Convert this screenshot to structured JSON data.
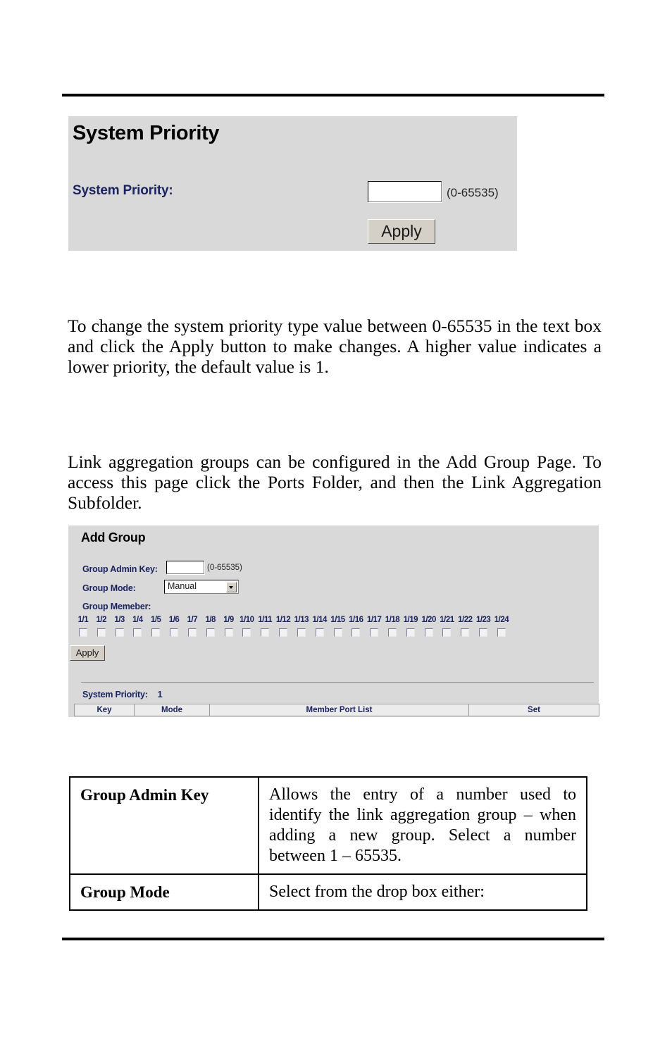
{
  "system_priority_panel": {
    "title": "System Priority",
    "field_label": "System Priority:",
    "field_value": "",
    "field_range": "(0-65535)",
    "apply_label": "Apply"
  },
  "paragraphs": {
    "p1": "To change the system priority type value between 0-65535 in the text box and click the Apply button to make changes.  A higher value indicates a lower priority, the default value is 1.",
    "p2": "Link aggregation groups can be configured in the Add Group Page. To access this page click the Ports Folder, and then the Link Aggregation Subfolder."
  },
  "add_group_panel": {
    "title": "Add Group",
    "admin_key_label": "Group Admin Key:",
    "admin_key_value": "",
    "admin_key_range": "(0-65535)",
    "mode_label": "Group Mode:",
    "mode_value": "Manual",
    "mode_options": [
      "Manual"
    ],
    "member_label": "Group Memeber:",
    "ports": [
      "1/1",
      "1/2",
      "1/3",
      "1/4",
      "1/5",
      "1/6",
      "1/7",
      "1/8",
      "1/9",
      "1/10",
      "1/11",
      "1/12",
      "1/13",
      "1/14",
      "1/15",
      "1/16",
      "1/17",
      "1/18",
      "1/19",
      "1/20",
      "1/21",
      "1/22",
      "1/23",
      "1/24"
    ],
    "apply_label": "Apply",
    "system_priority_label": "System Priority:",
    "system_priority_value": "1",
    "table_headers": [
      "Key",
      "Mode",
      "Member Port List",
      "Set"
    ],
    "table_rows": []
  },
  "description_table": {
    "rows": [
      {
        "term": "Group Admin Key",
        "definition": "Allows the entry of a number used to identify the link aggregation group – when adding a new group.  Select a number between 1 – 65535."
      },
      {
        "term": "Group Mode",
        "definition": "Select from the drop box either:"
      }
    ]
  },
  "colors": {
    "panel_background": "#d9d9d9",
    "label_blue": "#1b2460",
    "button_face": "#d4d0c8",
    "rule_black": "#000000"
  }
}
